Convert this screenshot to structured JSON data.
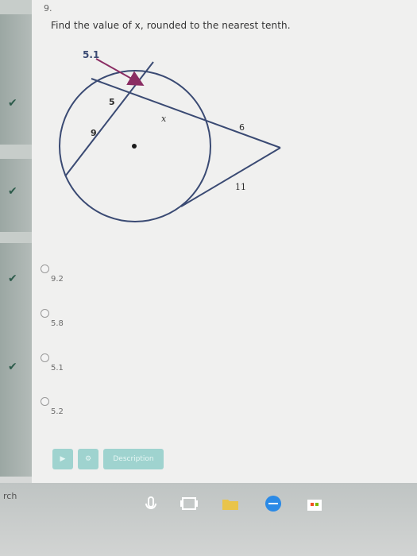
{
  "question": {
    "number": "9.",
    "prompt": "Find the value of x, rounded to the nearest tenth."
  },
  "figure": {
    "labels": {
      "top_value": "5.1",
      "seg_5": "5",
      "seg_9": "9",
      "seg_x": "x",
      "seg_6": "6",
      "seg_11": "11"
    },
    "colors": {
      "arrow": "#8a2d63",
      "lines": "#3a4a73"
    }
  },
  "options": [
    {
      "label": "9.2"
    },
    {
      "label": "5.8"
    },
    {
      "label": "5.1"
    },
    {
      "label": "5.2"
    }
  ],
  "buttons": {
    "description_label": "Description"
  },
  "taskbar": {
    "search_hint": "rch"
  }
}
